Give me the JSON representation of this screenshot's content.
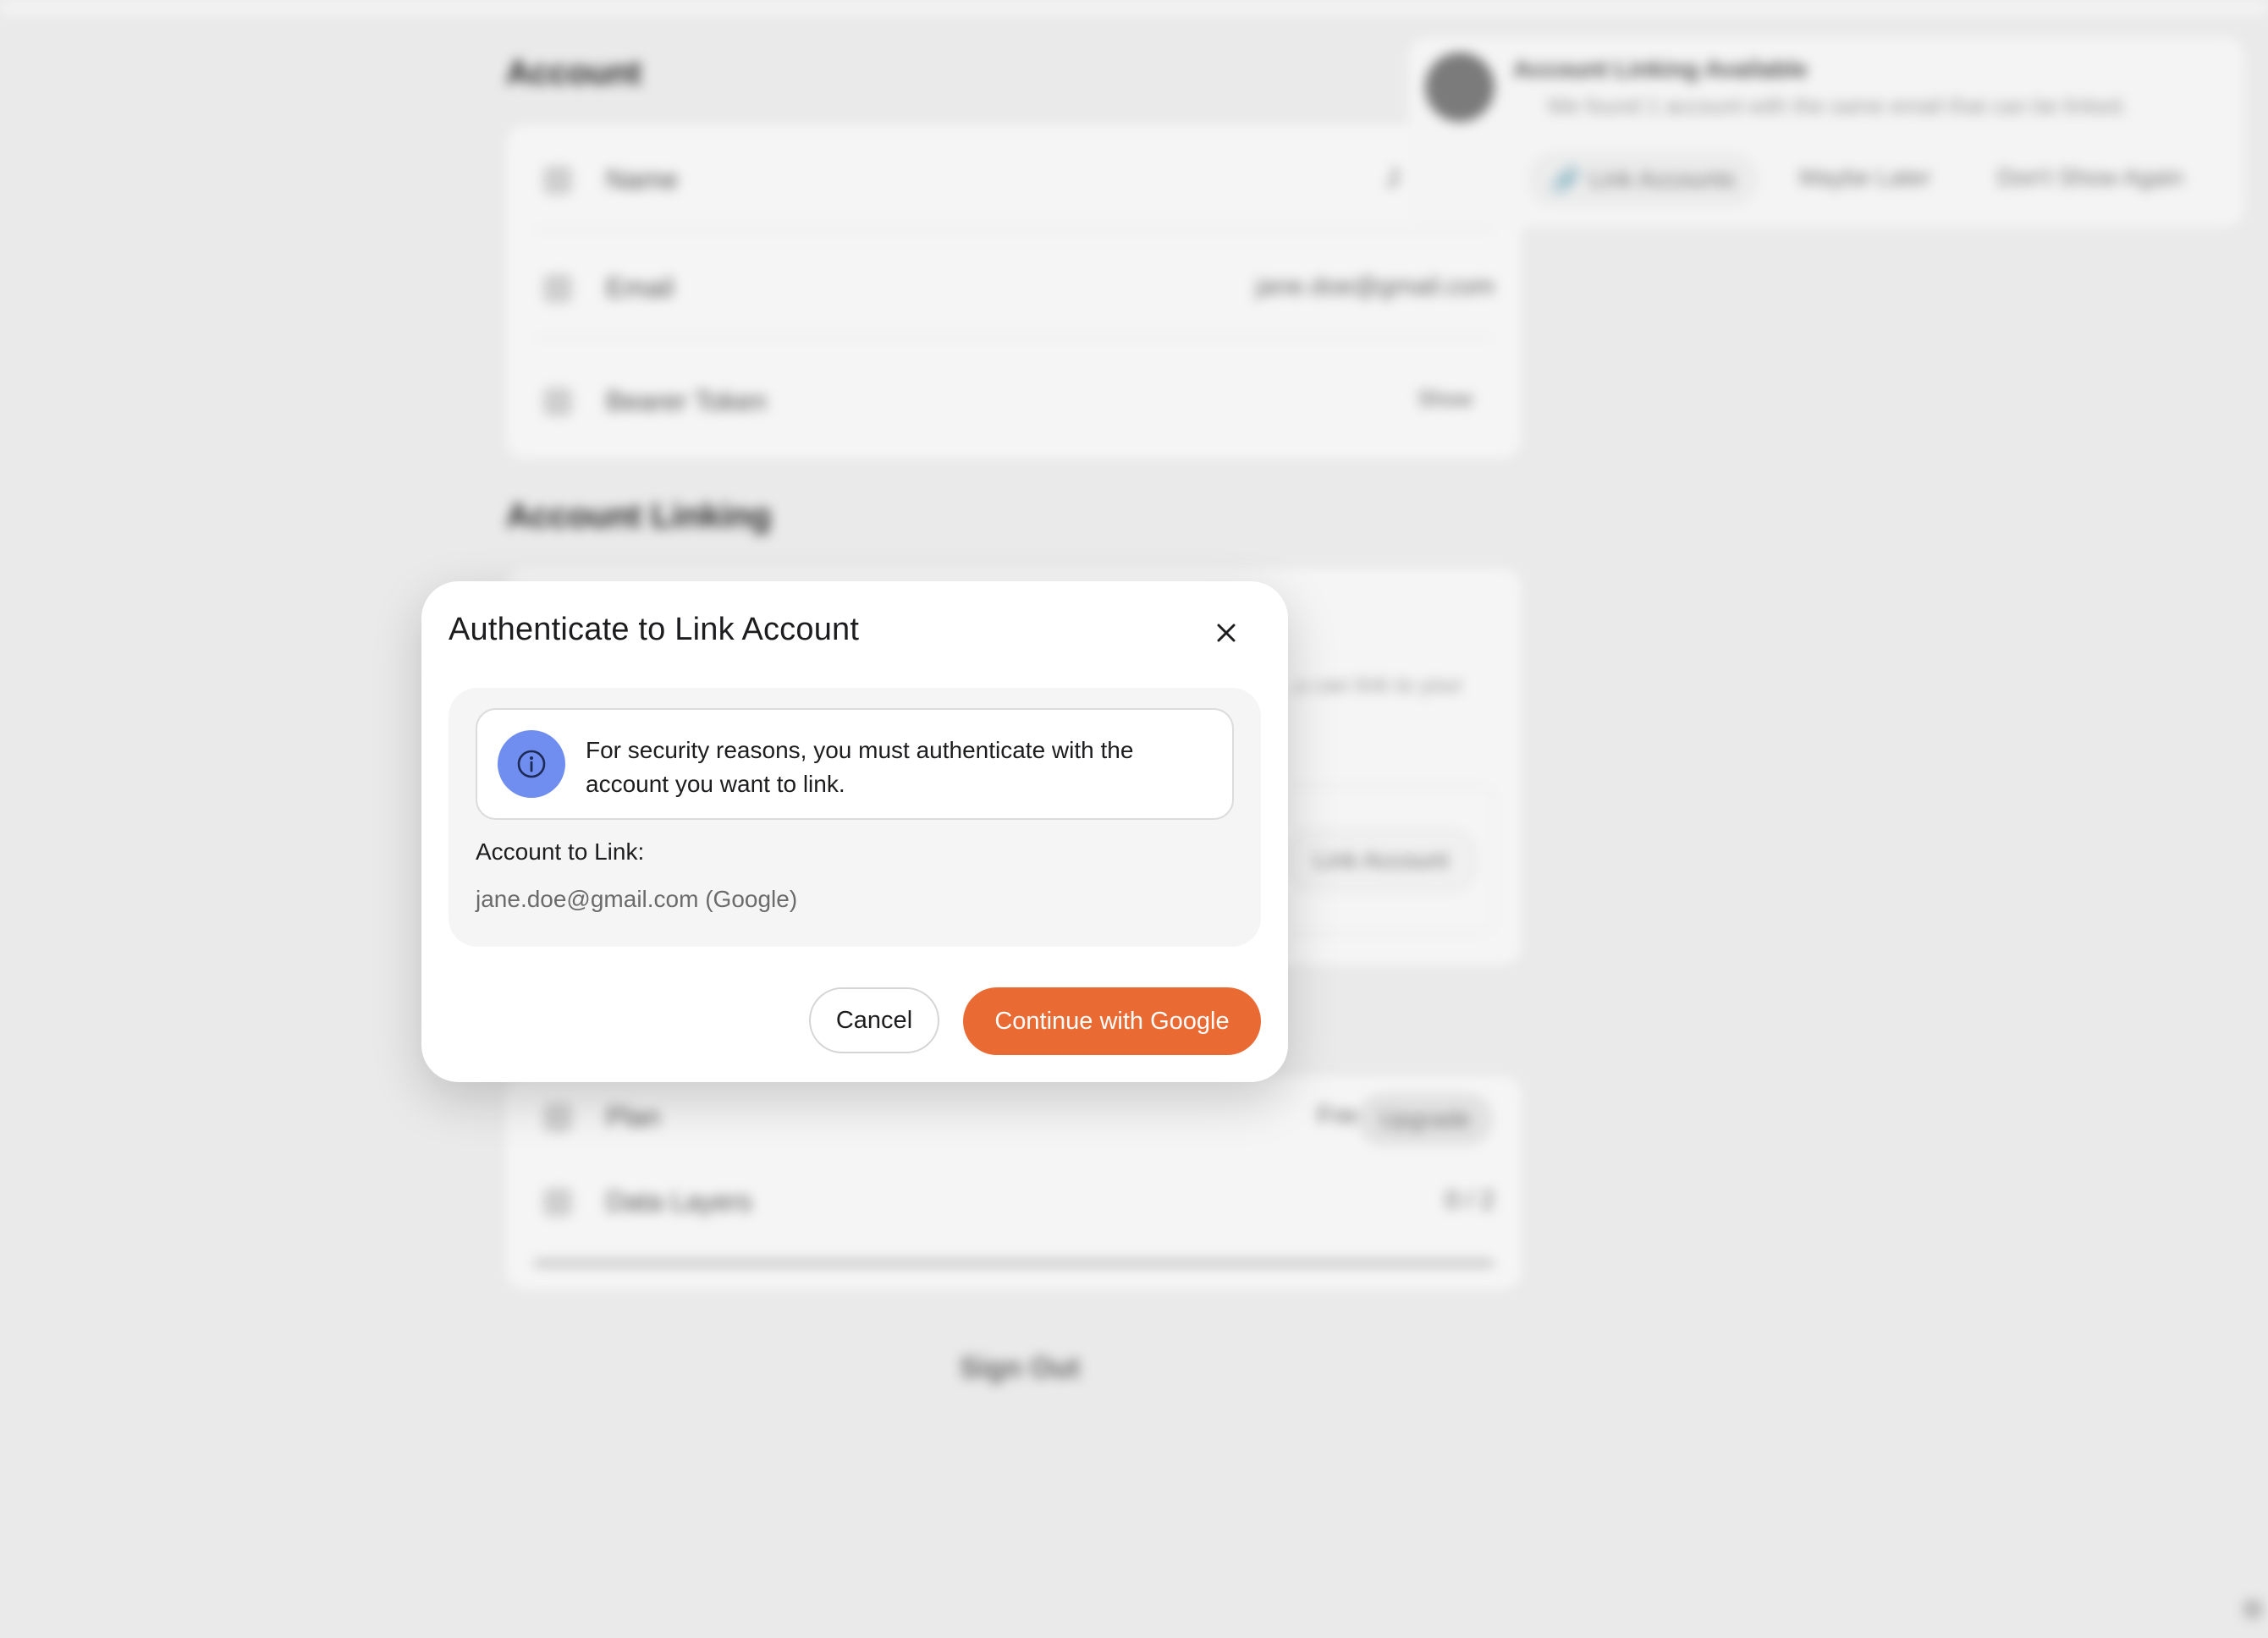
{
  "background": {
    "account_section": {
      "title": "Account",
      "rows": [
        {
          "label": "Name",
          "value": "J"
        },
        {
          "label": "Email",
          "value": "jane.doe@gmail.com"
        },
        {
          "label": "Bearer Token",
          "value": "Show"
        }
      ]
    },
    "linking_section": {
      "title": "Account Linking",
      "description": "...u can link to your",
      "link_button": "Link Account"
    },
    "plan_section": {
      "rows": [
        {
          "label": "Plan",
          "value": "Free",
          "action": "Upgrade"
        },
        {
          "label": "Data Layers",
          "value": "0 / 2"
        }
      ],
      "usage_fraction": 0
    },
    "sign_out": "Sign Out",
    "notification": {
      "title": "Account Linking Available",
      "message": "We found 1 account with the same email that can be linked.",
      "actions": [
        "Link Accounts",
        "Maybe Later",
        "Don't Show Again"
      ]
    }
  },
  "dialog": {
    "title": "Authenticate to Link Account",
    "close_icon": "close-icon",
    "info_icon": "info-icon",
    "info_text": "For security reasons, you must authenticate with the account you want to link.",
    "account_label": "Account to Link:",
    "account_value": "jane.doe@gmail.com (Google)",
    "cancel_label": "Cancel",
    "continue_label": "Continue with Google"
  },
  "colors": {
    "accent": "#ea6a33",
    "info_icon_bg": "#6f8ef0"
  }
}
